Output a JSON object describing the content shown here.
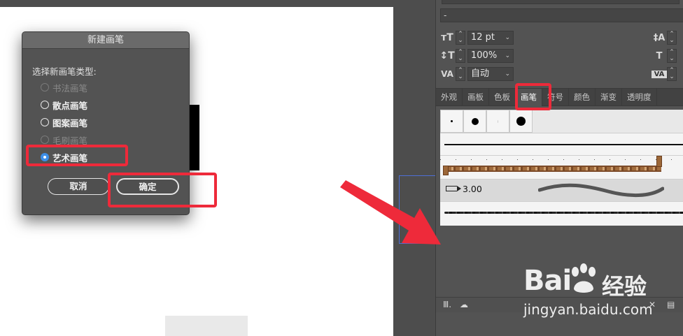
{
  "dialog": {
    "title": "新建画笔",
    "prompt": "选择新画笔类型:",
    "options": [
      {
        "label": "书法画笔",
        "enabled": false,
        "checked": false
      },
      {
        "label": "散点画笔",
        "enabled": true,
        "checked": false
      },
      {
        "label": "图案画笔",
        "enabled": true,
        "checked": false
      },
      {
        "label": "毛刷画笔",
        "enabled": false,
        "checked": false
      },
      {
        "label": "艺术画笔",
        "enabled": true,
        "checked": true
      }
    ],
    "cancel_label": "取消",
    "ok_label": "确定"
  },
  "panel": {
    "top_field_value": "-",
    "font_size": "12 pt",
    "vertical_scale": "100%",
    "kerning": "自动",
    "icons": {
      "font_size": "font-size-icon",
      "vertical_scale": "vertical-scale-icon",
      "kerning": "kerning-icon",
      "leading": "leading-icon",
      "horizontal_scale": "horizontal-scale-icon",
      "tracking": "tracking-icon"
    },
    "tabs": [
      "外观",
      "画板",
      "色板",
      "画笔",
      "符号",
      "颜色",
      "渐变",
      "透明度"
    ],
    "active_tab": "画笔",
    "brush_stroke_value": "3.00"
  },
  "watermark": {
    "brand": "Bai",
    "brand_suffix": "经验",
    "url": "jingyan.baidu.com"
  },
  "colors": {
    "highlight": "#ee2a3a",
    "radio_selected": "#3d8ee8",
    "panel_bg": "#535353"
  }
}
